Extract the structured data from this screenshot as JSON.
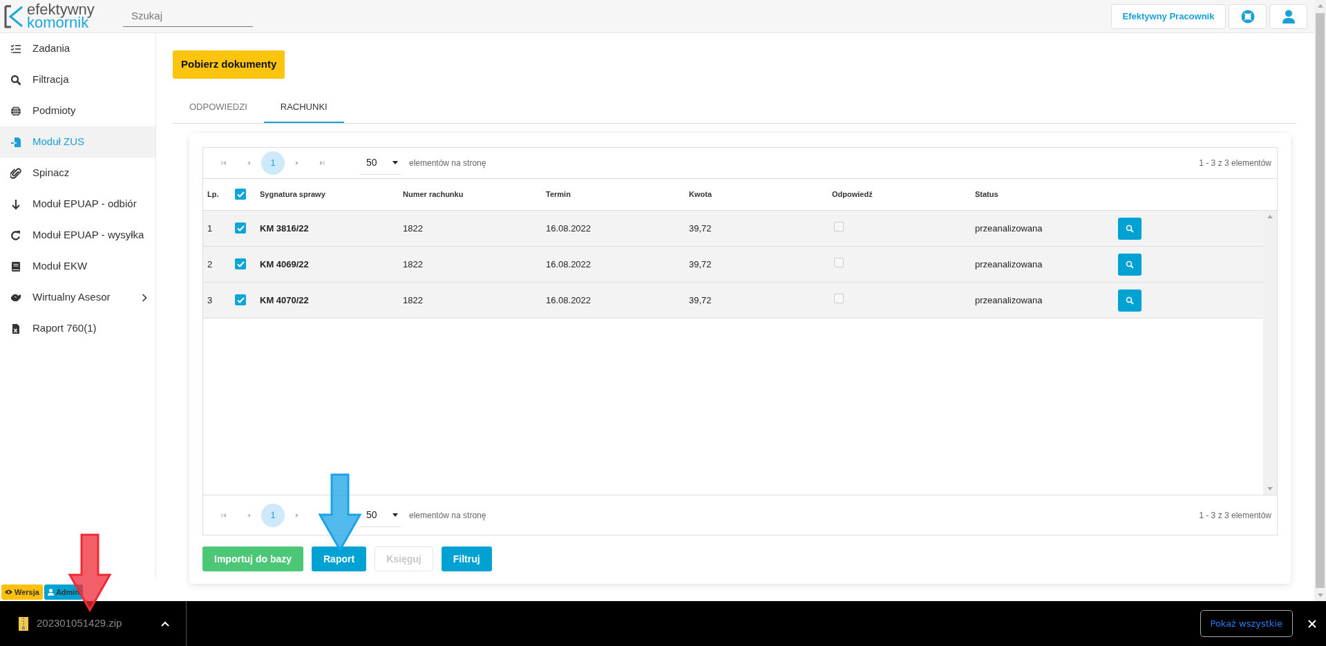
{
  "header": {
    "logo_top": "efektywny",
    "logo_bottom": "komornik",
    "search": {
      "placeholder": "Szukaj"
    },
    "user_button": "Efektywny Pracownik"
  },
  "sidebar": {
    "items": [
      {
        "label": "Zadania",
        "selected": false,
        "expandable": false
      },
      {
        "label": "Filtracja",
        "selected": false,
        "expandable": false
      },
      {
        "label": "Podmioty",
        "selected": false,
        "expandable": false
      },
      {
        "label": "Moduł ZUS",
        "selected": true,
        "expandable": false
      },
      {
        "label": "Spinacz",
        "selected": false,
        "expandable": false
      },
      {
        "label": "Moduł EPUAP - odbiór",
        "selected": false,
        "expandable": false
      },
      {
        "label": "Moduł EPUAP - wysyłka",
        "selected": false,
        "expandable": false
      },
      {
        "label": "Moduł EKW",
        "selected": false,
        "expandable": false
      },
      {
        "label": "Wirtualny Asesor",
        "selected": false,
        "expandable": true
      },
      {
        "label": "Raport 760(1)",
        "selected": false,
        "expandable": false
      }
    ]
  },
  "download_button": "Pobierz dokumenty",
  "tabs": [
    {
      "label": "ODPOWIEDZI",
      "selected": false
    },
    {
      "label": "RACHUNKI",
      "selected": true
    }
  ],
  "table": {
    "pager_top": {
      "page": "1",
      "page_size": "50",
      "per_page_label": "elementów na stronę",
      "range": "1 - 3 z 3 elementów"
    },
    "select_all": {
      "checked": true
    },
    "columns": [
      "Lp.",
      "Sygnatura sprawy",
      "Numer rachunku",
      "Termin",
      "Kwota",
      "Odpowiedź",
      "Status"
    ],
    "rows": [
      {
        "lp": "1",
        "checked": true,
        "signature": "KM 3816/22",
        "account": "1822",
        "due": "16.08.2022",
        "amount": "39,72",
        "answered": false,
        "status": "przeanalizowana"
      },
      {
        "lp": "2",
        "checked": true,
        "signature": "KM 4069/22",
        "account": "1822",
        "due": "16.08.2022",
        "amount": "39,72",
        "answered": false,
        "status": "przeanalizowana"
      },
      {
        "lp": "3",
        "checked": true,
        "signature": "KM 4070/22",
        "account": "1822",
        "due": "16.08.2022",
        "amount": "39,72",
        "answered": false,
        "status": "przeanalizowana"
      }
    ],
    "pager_bottom": {
      "page": "1",
      "page_size": "50",
      "per_page_label": "elementów na stronę",
      "range": "1 - 3 z 3 elementów"
    }
  },
  "actions": [
    {
      "label": "Importuj do bazy",
      "kind": "success",
      "disabled": false
    },
    {
      "label": "Raport",
      "kind": "info",
      "disabled": false
    },
    {
      "label": "Księguj",
      "kind": "light",
      "disabled": true
    },
    {
      "label": "Filtruj",
      "kind": "info",
      "disabled": false
    }
  ],
  "badges": [
    {
      "label": "Wersja",
      "kind": "eye",
      "color": "#ffc107"
    },
    {
      "label": "Admin",
      "kind": "user",
      "color": "#00a2d3"
    }
  ],
  "download_bar": {
    "file": "202301051429.zip",
    "show_all": "Pokaż wszystkie"
  },
  "annotations": [
    {
      "color": "#ee2a36"
    },
    {
      "color": "#1aa3e8"
    }
  ]
}
